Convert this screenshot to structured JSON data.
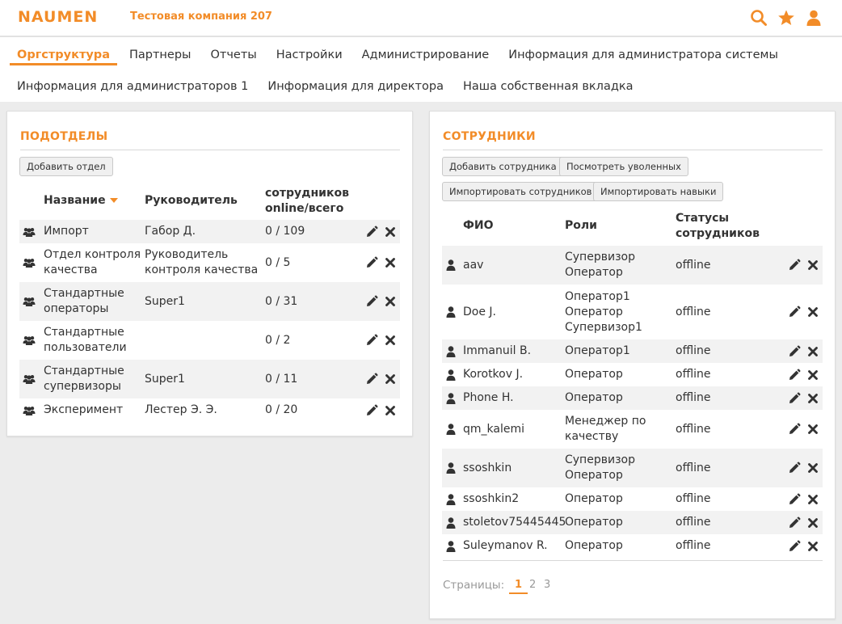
{
  "header": {
    "logo": "NAUMEN",
    "company": "Тестовая компания 207",
    "icons": [
      "search-icon",
      "star-icon",
      "user-icon"
    ],
    "accent": "#f28c28"
  },
  "nav": {
    "row1": [
      "Оргструктура",
      "Партнеры",
      "Отчеты",
      "Настройки",
      "Администрирование",
      "Информация для администратора системы"
    ],
    "row2": [
      "Информация для администраторов 1",
      "Информация для директора",
      "Наша собственная вкладка"
    ],
    "active": "Оргструктура"
  },
  "subdivisions": {
    "title": "ПОДОТДЕЛЫ",
    "add_button": "Добавить отдел",
    "columns": {
      "name": "Название",
      "head": "Руководитель",
      "count_line1": "сотрудников",
      "count_line2": "online/всего"
    },
    "rows": [
      {
        "name": [
          "Импорт"
        ],
        "head": [
          "Габор Д."
        ],
        "count": "0 / 109"
      },
      {
        "name": [
          "Отдел контроля",
          "качества"
        ],
        "head": [
          "Руководитель",
          "контроля качества"
        ],
        "count": "0 / 5"
      },
      {
        "name": [
          "Стандартные",
          "операторы"
        ],
        "head": [
          "Super1"
        ],
        "count": "0 / 31"
      },
      {
        "name": [
          "Стандартные",
          "пользователи"
        ],
        "head": [],
        "count": "0 / 2"
      },
      {
        "name": [
          "Стандартные",
          "супервизоры"
        ],
        "head": [
          "Super1"
        ],
        "count": "0 / 11"
      },
      {
        "name": [
          "Эксперимент"
        ],
        "head": [
          "Лестер Э. Э."
        ],
        "count": "0 / 20"
      }
    ]
  },
  "employees": {
    "title": "СОТРУДНИКИ",
    "buttons": {
      "add": "Добавить сотрудника",
      "fired": "Посмотреть уволенных",
      "import_emp": "Импортировать сотрудников",
      "import_skills": "Импортировать навыки"
    },
    "columns": {
      "fio": "ФИО",
      "roles": "Роли",
      "status_line1": "Статусы",
      "status_line2": "сотрудников"
    },
    "rows": [
      {
        "fio": "aav",
        "roles": [
          "Супервизор",
          "Оператор"
        ],
        "status": "offline"
      },
      {
        "fio": "Doe J.",
        "roles": [
          "Оператор1",
          "Оператор",
          "Супервизор1"
        ],
        "status": "offline"
      },
      {
        "fio": "Immanuil B.",
        "roles": [
          "Оператор1"
        ],
        "status": "offline"
      },
      {
        "fio": "Korotkov J.",
        "roles": [
          "Оператор"
        ],
        "status": "offline"
      },
      {
        "fio": "Phone H.",
        "roles": [
          "Оператор"
        ],
        "status": "offline"
      },
      {
        "fio": "qm_kalemi",
        "roles": [
          "Менеджер по",
          "качеству"
        ],
        "status": "offline"
      },
      {
        "fio": "ssoshkin",
        "roles": [
          "Супервизор",
          "Оператор"
        ],
        "status": "offline"
      },
      {
        "fio": "ssoshkin2",
        "roles": [
          "Оператор"
        ],
        "status": "offline"
      },
      {
        "fio": "stoletov75445445",
        "roles": [
          "Оператор"
        ],
        "status": "offline"
      },
      {
        "fio": "Suleymanov R.",
        "roles": [
          "Оператор"
        ],
        "status": "offline"
      }
    ],
    "pager": {
      "label": "Страницы:",
      "pages": [
        "1",
        "2",
        "3"
      ],
      "current": "1"
    }
  }
}
